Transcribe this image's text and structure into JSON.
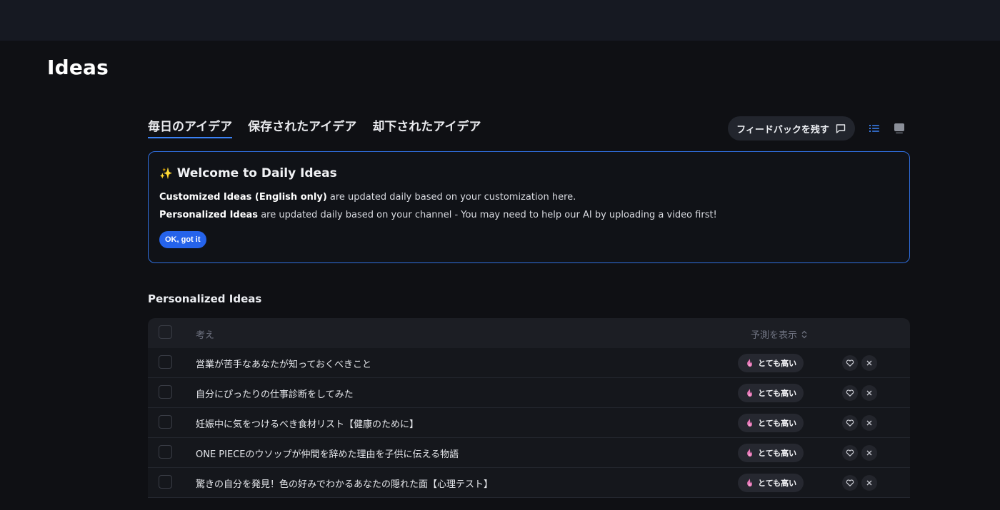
{
  "page": {
    "title": "Ideas"
  },
  "tabs": [
    {
      "label": "毎日のアイデア",
      "active": true
    },
    {
      "label": "保存されたアイデア",
      "active": false
    },
    {
      "label": "却下されたアイデア",
      "active": false
    }
  ],
  "toolbar": {
    "feedback_label": "フィードバックを残す",
    "feedback_icon": "message-square-icon",
    "list_view_icon": "list-icon",
    "grid_view_icon": "card-view-icon"
  },
  "welcome": {
    "icon": "sparkles-icon",
    "title": "Welcome to Daily Ideas",
    "line1_bold": "Customized Ideas (English only)",
    "line1_rest": " are updated daily based on your customization here.",
    "line2_bold": "Personalized Ideas",
    "line2_rest": " are updated daily based on your channel - You may need to help our AI by uploading a video first!",
    "ok_label": "OK, got it"
  },
  "section": {
    "title": "Personalized Ideas"
  },
  "table": {
    "header_idea": "考え",
    "header_prediction": "予測を表示",
    "rows": [
      {
        "idea": "営業が苦手なあなたが知っておくべきこと",
        "prediction": "とても高い"
      },
      {
        "idea": "自分にぴったりの仕事診断をしてみた",
        "prediction": "とても高い"
      },
      {
        "idea": "妊娠中に気をつけるべき食材リスト【健康のために】",
        "prediction": "とても高い"
      },
      {
        "idea": "ONE PIECEのウソップが仲間を辞めた理由を子供に伝える物語",
        "prediction": "とても高い"
      },
      {
        "idea": "驚きの自分を発見！色の好みでわかるあなたの隠れた面【心理テスト】",
        "prediction": "とても高い"
      }
    ]
  },
  "colors": {
    "accent": "#2563eb",
    "border_accent": "#2f6fe0",
    "background": "#0f1014"
  }
}
